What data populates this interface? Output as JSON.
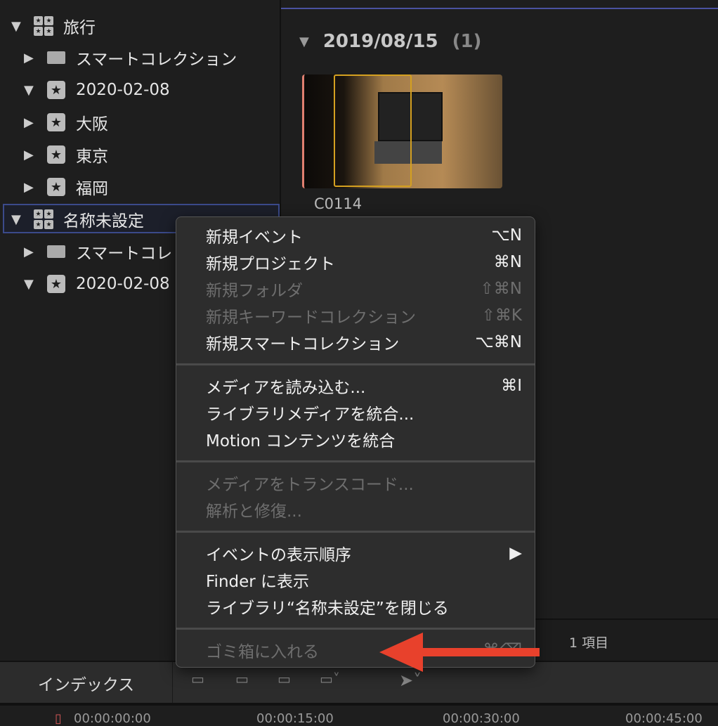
{
  "sidebar": {
    "items": [
      {
        "label": "旅行",
        "type": "library",
        "expanded": true
      },
      {
        "label": "スマートコレクション",
        "type": "folder",
        "expanded": false
      },
      {
        "label": "2020-02-08",
        "type": "event",
        "expanded": true
      },
      {
        "label": "大阪",
        "type": "event",
        "expanded": false
      },
      {
        "label": "東京",
        "type": "event",
        "expanded": false
      },
      {
        "label": "福岡",
        "type": "event",
        "expanded": false
      },
      {
        "label": "名称未設定",
        "type": "library",
        "expanded": true,
        "selected": true
      },
      {
        "label": "スマートコレ",
        "type": "folder",
        "expanded": false
      },
      {
        "label": "2020-02-08",
        "type": "event",
        "expanded": true
      }
    ]
  },
  "browser": {
    "date": "2019/08/15",
    "count": "(1)",
    "clip": "C0114",
    "status": "1 項目"
  },
  "menu": {
    "items": [
      {
        "label": "新規イベント",
        "shortcut": "⌥N",
        "enabled": true
      },
      {
        "label": "新規プロジェクト",
        "shortcut": "⌘N",
        "enabled": true
      },
      {
        "label": "新規フォルダ",
        "shortcut": "⇧⌘N",
        "enabled": false
      },
      {
        "label": "新規キーワードコレクション",
        "shortcut": "⇧⌘K",
        "enabled": false
      },
      {
        "label": "新規スマートコレクション",
        "shortcut": "⌥⌘N",
        "enabled": true
      },
      {
        "label": "メディアを読み込む...",
        "shortcut": "⌘I",
        "enabled": true
      },
      {
        "label": "ライブラリメディアを統合...",
        "shortcut": "",
        "enabled": true
      },
      {
        "label": "Motion コンテンツを統合",
        "shortcut": "",
        "enabled": true
      },
      {
        "label": "メディアをトランスコード...",
        "shortcut": "",
        "enabled": false
      },
      {
        "label": "解析と修復...",
        "shortcut": "",
        "enabled": false
      },
      {
        "label": "イベントの表示順序",
        "shortcut": "▶",
        "enabled": true
      },
      {
        "label": "Finder に表示",
        "shortcut": "",
        "enabled": true
      },
      {
        "label": "ライブラリ“名称未設定”を閉じる",
        "shortcut": "",
        "enabled": true
      },
      {
        "label": "ゴミ箱に入れる",
        "shortcut": "⌘⌫",
        "enabled": false
      }
    ]
  },
  "toolbar": {
    "index_label": "インデックス"
  },
  "timeline": {
    "ticks": [
      "00:00:00:00",
      "00:00:15:00",
      "00:00:30:00",
      "00:00:45:00"
    ]
  },
  "colors": {
    "accent_arrow": "#e8412c",
    "selection": "#3b4a8a",
    "skimmer": "#d4a020"
  }
}
